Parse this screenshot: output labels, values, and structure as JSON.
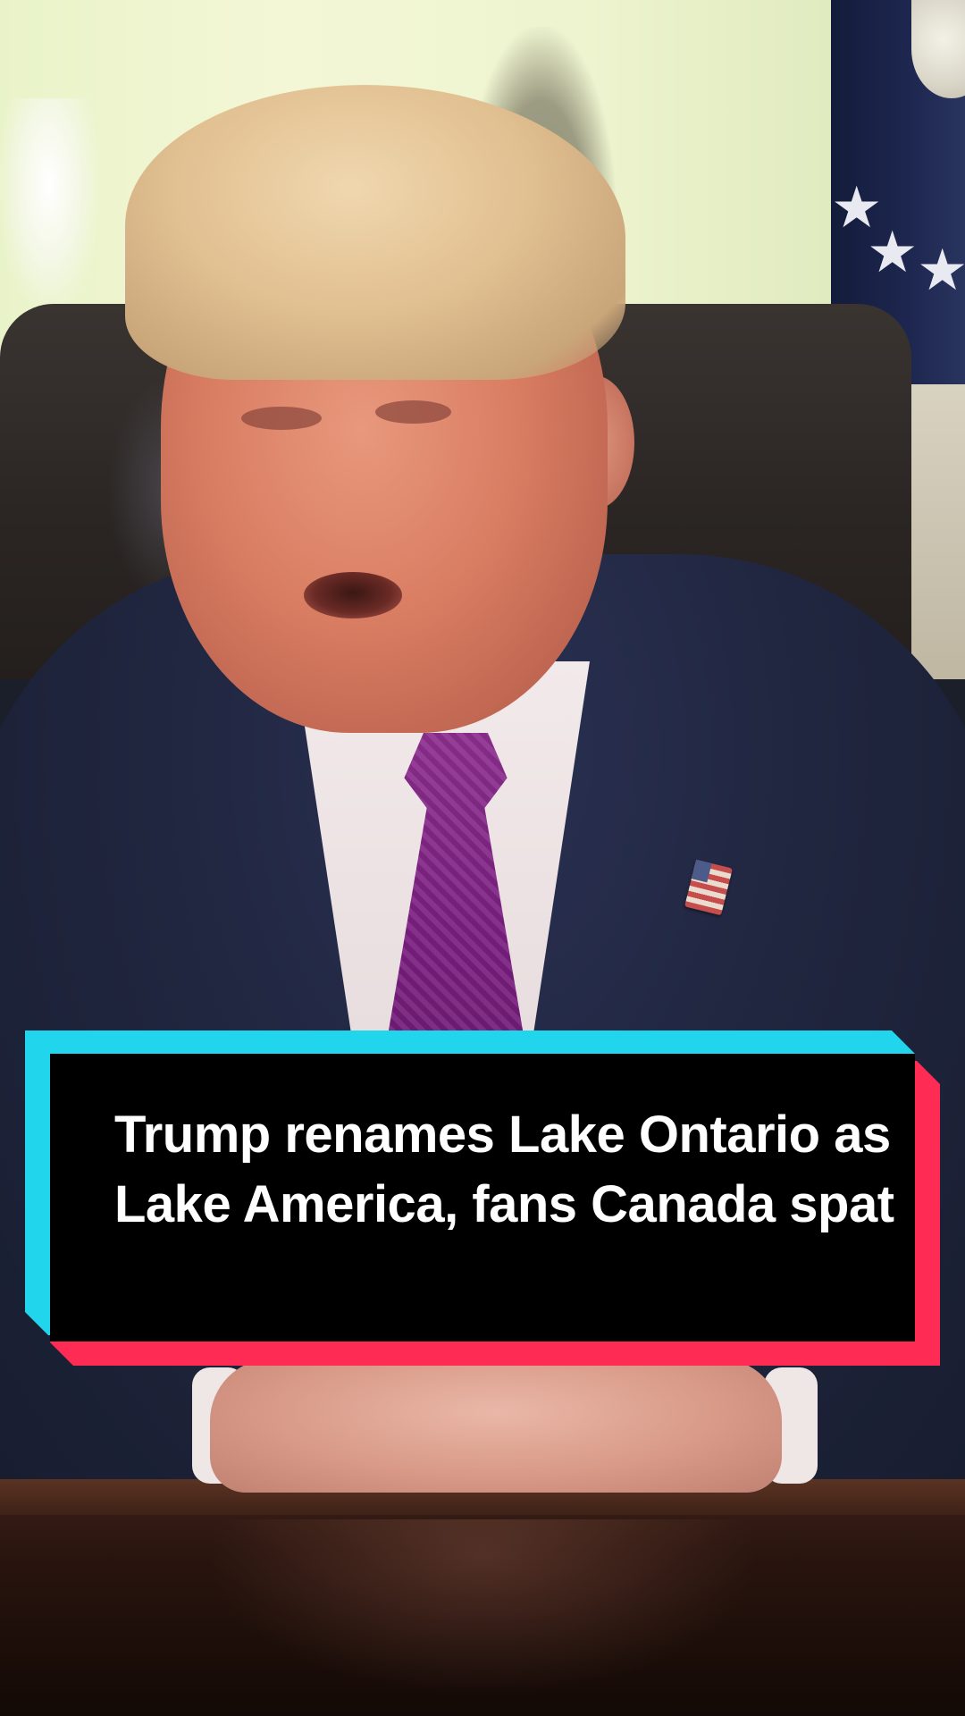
{
  "video": {
    "caption": "Trump renames Lake Ontario as Lake America, fans Canada spat"
  },
  "colors": {
    "caption_background": "#000000",
    "caption_text": "#ffffff",
    "accent_cyan": "#20d5ec",
    "accent_red": "#fe2c55"
  }
}
